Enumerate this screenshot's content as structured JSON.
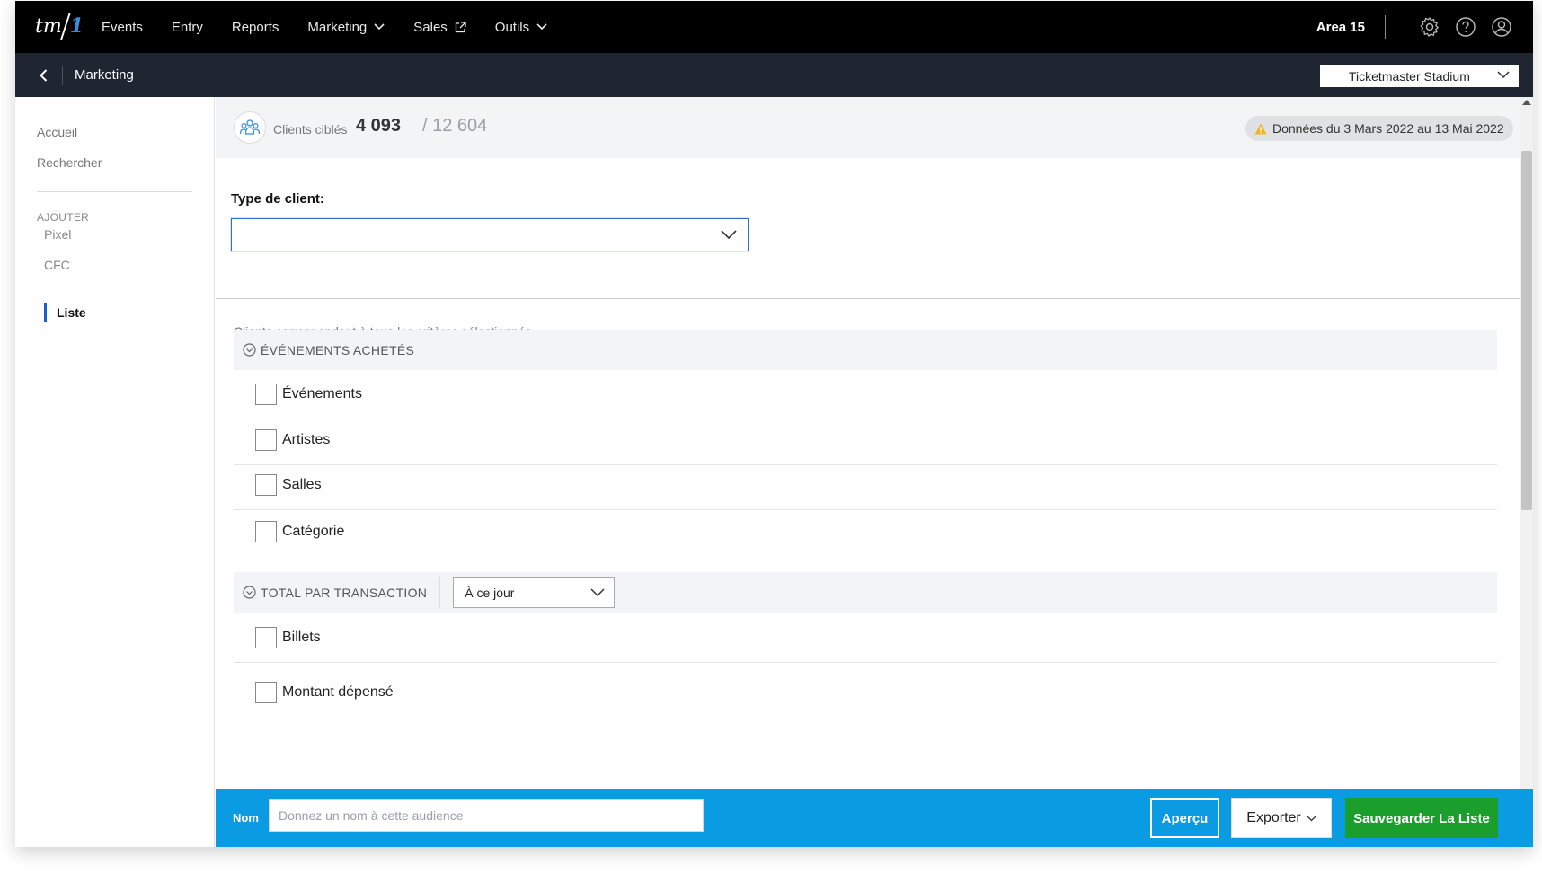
{
  "topnav": {
    "logo_text": "tm",
    "logo_accent": "1",
    "items": [
      {
        "label": "Events",
        "icon": ""
      },
      {
        "label": "Entry",
        "icon": ""
      },
      {
        "label": "Reports",
        "icon": ""
      },
      {
        "label": "Marketing",
        "icon": "chevron-down-icon"
      },
      {
        "label": "Sales",
        "icon": "external-link-icon"
      },
      {
        "label": "Outils",
        "icon": "chevron-down-icon"
      }
    ],
    "venue": "Area 15",
    "right_icons": [
      "gear-icon",
      "help-icon",
      "user-icon"
    ]
  },
  "subheader": {
    "title": "Marketing",
    "venue_select": "Ticketmaster Stadium"
  },
  "sidebar": {
    "links": [
      "Accueil",
      "Rechercher"
    ],
    "section_heading": "AJOUTER",
    "sub_items": [
      "Pixel",
      "CFC"
    ],
    "active_item": "Liste"
  },
  "stats": {
    "label": "Clients ciblés",
    "count": "4 093",
    "total": "/ 12 604",
    "date_range": "Données du 3 Mars 2022 au 13 Mai 2022"
  },
  "filters": {
    "type_label": "Type de client:",
    "type_value": "",
    "criteria_note": "Clients correspondant à tous les critères sélectionnés"
  },
  "sections": {
    "events": {
      "title": "ÉVÉNEMENTS ACHETÉS",
      "options": [
        "Événements",
        "Artistes",
        "Salles",
        "Catégorie"
      ]
    },
    "transaction": {
      "title": "TOTAL PAR TRANSACTION",
      "period": "À ce jour",
      "options": [
        "Billets",
        "Montant dépensé"
      ]
    }
  },
  "footer": {
    "name_label": "Nom",
    "name_placeholder": "Donnez un nom à cette audience",
    "preview_label": "Aperçu",
    "export_label": "Exporter",
    "save_label": "Sauvegarder La Liste"
  },
  "colors": {
    "topnav_bg": "#000000",
    "subheader_bg": "#1f2631",
    "footer_bg": "#0a9be3",
    "save_button": "#1a9e2c",
    "accent_blue": "#1a5fd1",
    "warning": "#f0b323"
  }
}
